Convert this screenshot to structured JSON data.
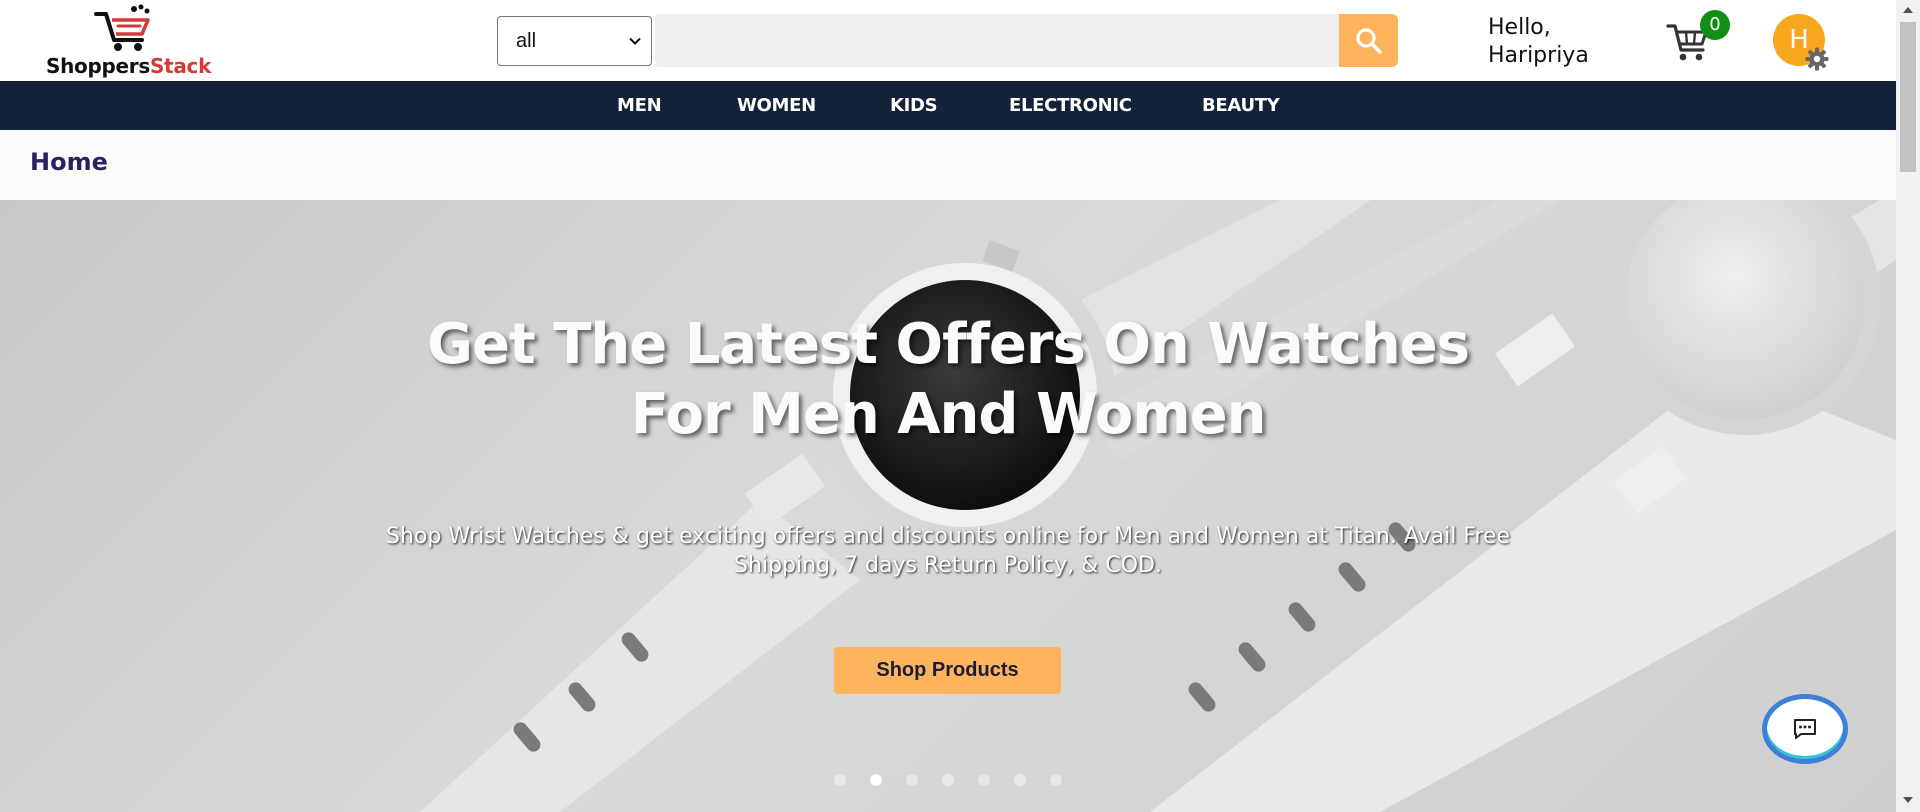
{
  "header": {
    "logo_text_part1": "Shoppers",
    "logo_text_part2": "Stack",
    "category_select_value": "all",
    "search_placeholder": "",
    "greeting_line1": "Hello,",
    "greeting_line2": "Haripriya",
    "cart_count": "0",
    "avatar_initial": "H"
  },
  "nav": {
    "items": [
      "MEN",
      "WOMEN",
      "KIDS",
      "ELECTRONIC",
      "BEAUTY"
    ]
  },
  "breadcrumb": {
    "label": "Home"
  },
  "hero": {
    "title": "Get The Latest Offers On Watches For Men And Women",
    "subtitle": "Shop Wrist Watches & get exciting offers and discounts online for Men and Women at Titan. Avail Free Shipping, 7 days Return Policy, & COD.",
    "button_label": "Shop Products",
    "slide_count": 7,
    "active_slide": 2
  },
  "colors": {
    "nav_background": "#142139",
    "accent_orange": "#fdb45d",
    "cart_badge": "#0f8f14",
    "avatar": "#f7a61e",
    "breadcrumb_text": "#2f1f5e",
    "logo_red": "#d33a3a"
  },
  "icons": {
    "search": "search-icon",
    "cart": "cart-icon",
    "settings": "gear-icon",
    "chat": "chat-icon",
    "chevron": "chevron-down-icon"
  }
}
